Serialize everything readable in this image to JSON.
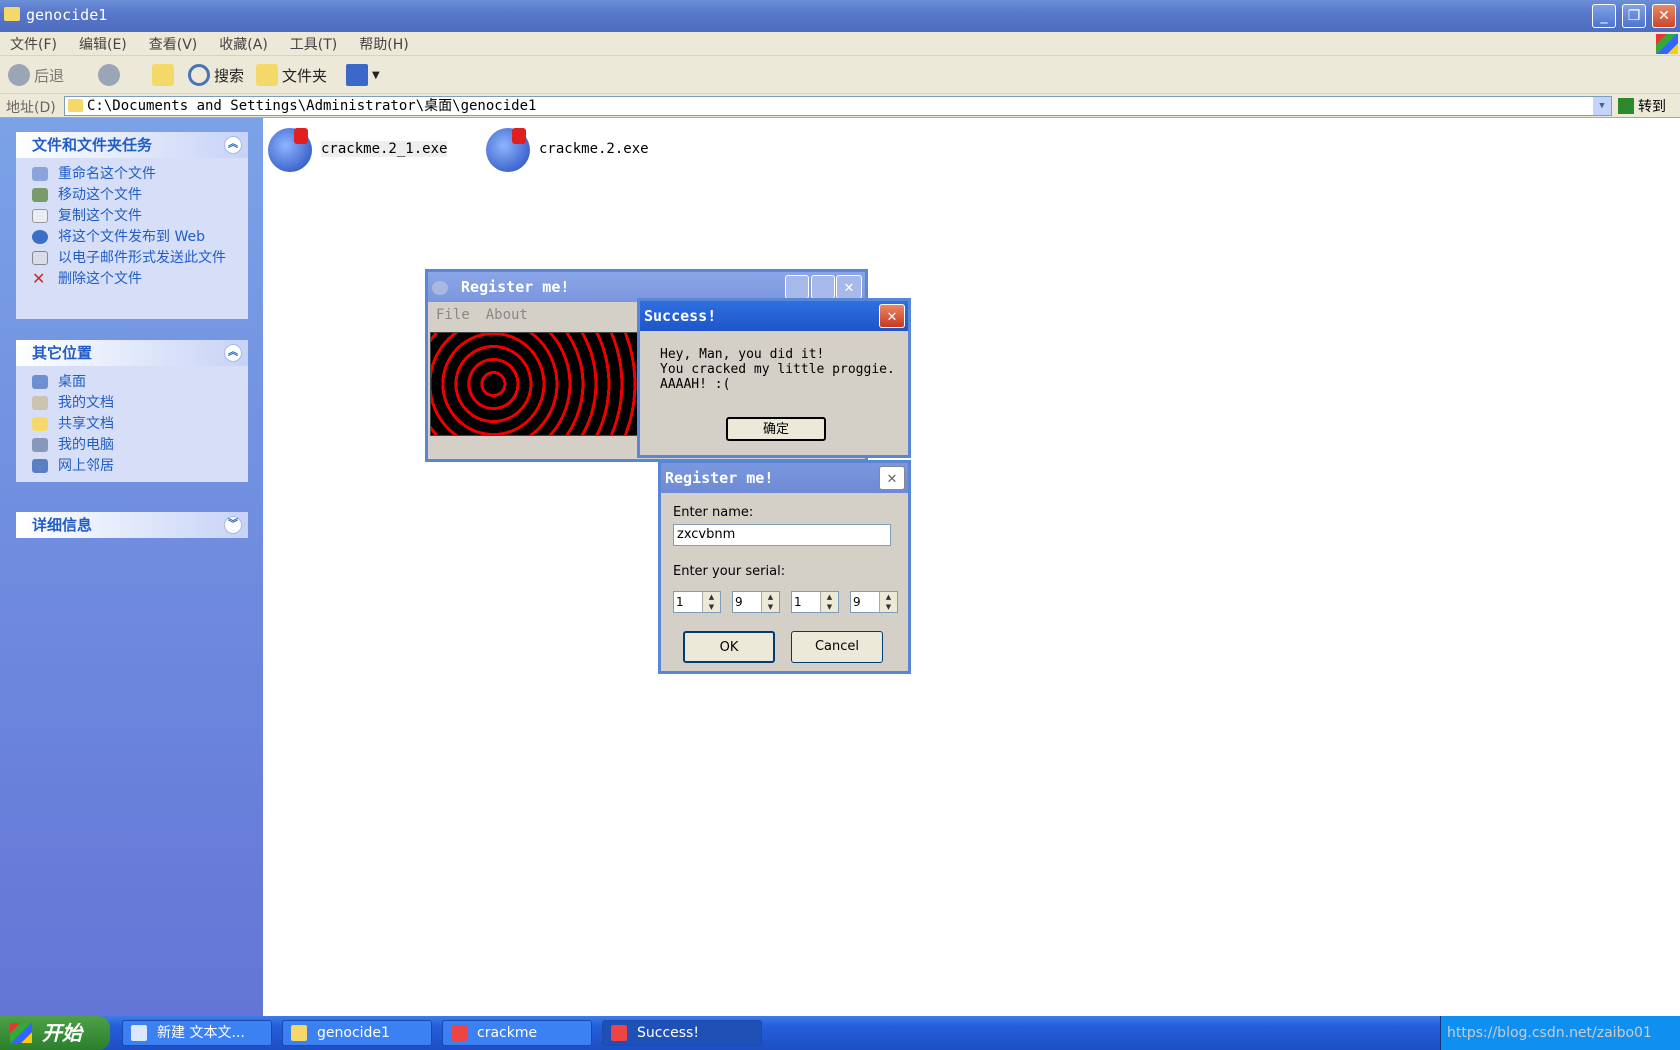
{
  "window": {
    "title": "genocide1"
  },
  "menu": [
    "文件(F)",
    "编辑(E)",
    "查看(V)",
    "收藏(A)",
    "工具(T)",
    "帮助(H)"
  ],
  "toolbar": {
    "back": "后退",
    "search": "搜索",
    "folders": "文件夹"
  },
  "address": {
    "label": "地址(D)",
    "path": "C:\\Documents and Settings\\Administrator\\桌面\\genocide1",
    "go": "转到"
  },
  "sidebar": {
    "tasks": {
      "title": "文件和文件夹任务",
      "items": [
        "重命名这个文件",
        "移动这个文件",
        "复制这个文件",
        "将这个文件发布到 Web",
        "以电子邮件形式发送此文件",
        "删除这个文件"
      ]
    },
    "places": {
      "title": "其它位置",
      "items": [
        "桌面",
        "我的文档",
        "共享文档",
        "我的电脑",
        "网上邻居"
      ]
    },
    "details": {
      "title": "详细信息"
    }
  },
  "files": [
    "crackme.2_1.exe",
    "crackme.2.exe"
  ],
  "register_main": {
    "title": "Register me!",
    "menu": [
      "File",
      "About"
    ]
  },
  "success": {
    "title": "Success!",
    "lines": [
      "Hey, Man, you did it!",
      "You cracked my little proggie.",
      "AAAAH! :("
    ],
    "ok": "确定"
  },
  "register_dialog": {
    "title": "Register me!",
    "name_label": "Enter name:",
    "name_value": "zxcvbnm",
    "serial_label": "Enter your serial:",
    "serial": [
      "1",
      "9",
      "1",
      "9"
    ],
    "ok": "OK",
    "cancel": "Cancel"
  },
  "taskbar": {
    "start": "开始",
    "tasks": [
      "新建 文本文...",
      "genocide1",
      "crackme",
      "Success!"
    ],
    "watermark": "https://blog.csdn.net/zaibo01"
  }
}
